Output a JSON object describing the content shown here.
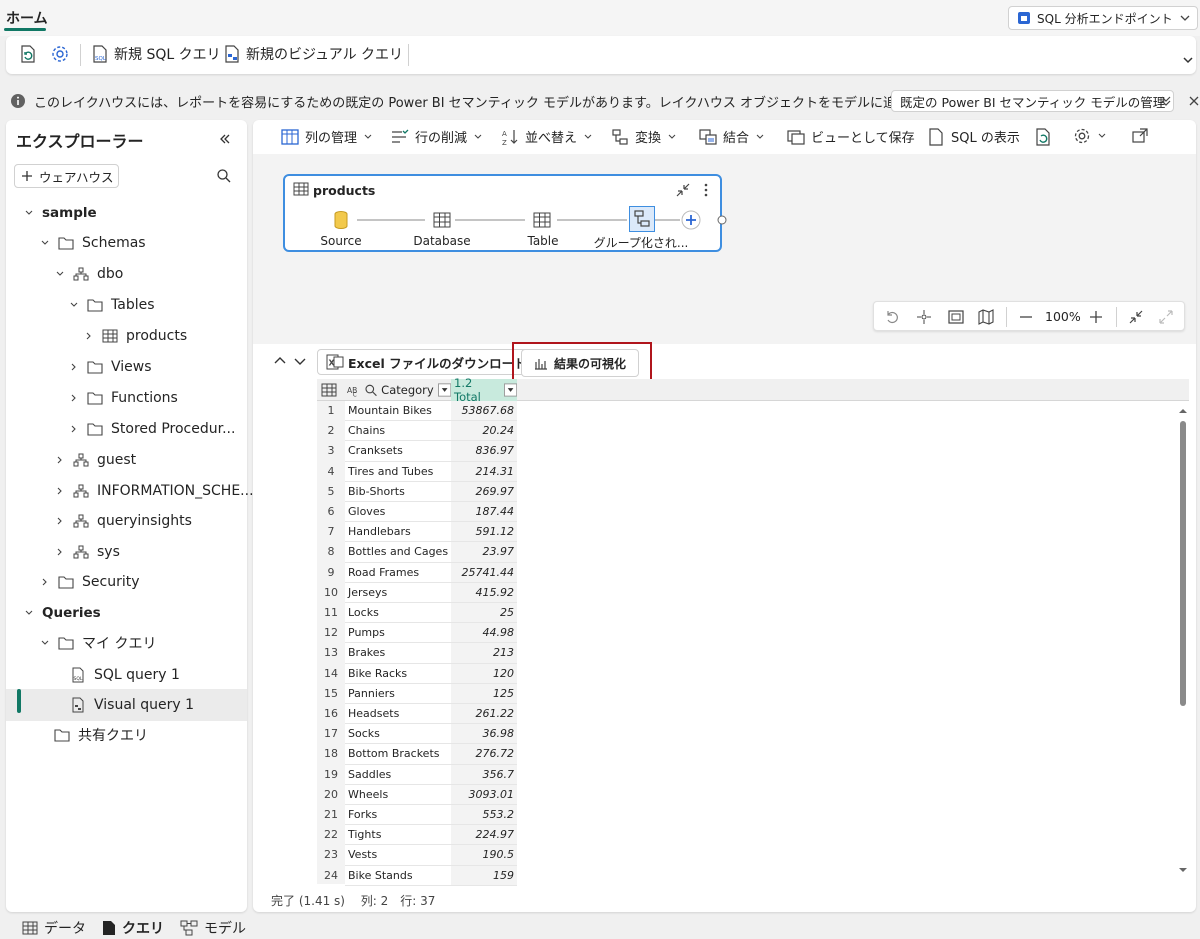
{
  "tabs": {
    "home": "ホーム"
  },
  "endpoint": {
    "label": "SQL 分析エンドポイント"
  },
  "ribbon": {
    "new_sql_query": "新規 SQL クエリ",
    "new_visual_query": "新規のビジュアル クエリ"
  },
  "infobar": {
    "message": "このレイクハウスには、レポートを容易にするための既定の Power BI セマンティック モデルがあります。レイクハウス オブジェクトをモデルに追加するには...",
    "manage_button": "既定の Power BI セマンティック モデルの管理"
  },
  "explorer": {
    "title": "エクスプローラー",
    "warehouse_button": "ウェアハウス",
    "tree": {
      "sample": "sample",
      "schemas": "Schemas",
      "dbo": "dbo",
      "tables": "Tables",
      "products": "products",
      "views": "Views",
      "functions": "Functions",
      "stored_procedures": "Stored Procedur...",
      "guest": "guest",
      "information_schema": "INFORMATION_SCHE...",
      "queryinsights": "queryinsights",
      "sys": "sys",
      "security": "Security",
      "queries": "Queries",
      "my_queries": "マイ クエリ",
      "sql_query_1": "SQL query 1",
      "visual_query_1": "Visual query 1",
      "shared_queries": "共有クエリ"
    }
  },
  "toolbar": {
    "manage_columns": "列の管理",
    "reduce_rows": "行の削減",
    "sort": "並べ替え",
    "transform": "変換",
    "combine": "結合",
    "save_as_view": "ビューとして保存",
    "view_sql": "SQL の表示"
  },
  "diagram": {
    "card_title": "products",
    "steps": [
      "Source",
      "Database",
      "Table",
      "グループ化され..."
    ]
  },
  "zoom": {
    "level": "100%"
  },
  "results": {
    "excel_button": "Excel ファイルのダウンロード",
    "visualize_button": "結果の可視化",
    "columns": {
      "category": "Category",
      "total": "1.2 Total"
    },
    "rows": [
      [
        "1",
        "Mountain Bikes",
        "53867.68"
      ],
      [
        "2",
        "Chains",
        "20.24"
      ],
      [
        "3",
        "Cranksets",
        "836.97"
      ],
      [
        "4",
        "Tires and Tubes",
        "214.31"
      ],
      [
        "5",
        "Bib-Shorts",
        "269.97"
      ],
      [
        "6",
        "Gloves",
        "187.44"
      ],
      [
        "7",
        "Handlebars",
        "591.12"
      ],
      [
        "8",
        "Bottles and Cages",
        "23.97"
      ],
      [
        "9",
        "Road Frames",
        "25741.44"
      ],
      [
        "10",
        "Jerseys",
        "415.92"
      ],
      [
        "11",
        "Locks",
        "25"
      ],
      [
        "12",
        "Pumps",
        "44.98"
      ],
      [
        "13",
        "Brakes",
        "213"
      ],
      [
        "14",
        "Bike Racks",
        "120"
      ],
      [
        "15",
        "Panniers",
        "125"
      ],
      [
        "16",
        "Headsets",
        "261.22"
      ],
      [
        "17",
        "Socks",
        "36.98"
      ],
      [
        "18",
        "Bottom Brackets",
        "276.72"
      ],
      [
        "19",
        "Saddles",
        "356.7"
      ],
      [
        "20",
        "Wheels",
        "3093.01"
      ],
      [
        "21",
        "Forks",
        "553.2"
      ],
      [
        "22",
        "Tights",
        "224.97"
      ],
      [
        "23",
        "Vests",
        "190.5"
      ],
      [
        "24",
        "Bike Stands",
        "159"
      ]
    ],
    "status": "完了 (1.41 s)　 列: 2　行: 37"
  },
  "bottom_nav": {
    "data": "データ",
    "query": "クエリ",
    "model": "モデル"
  },
  "colors": {
    "accent": "#117865",
    "highlight": "#b0151c",
    "selection": "#3e8ee0"
  }
}
